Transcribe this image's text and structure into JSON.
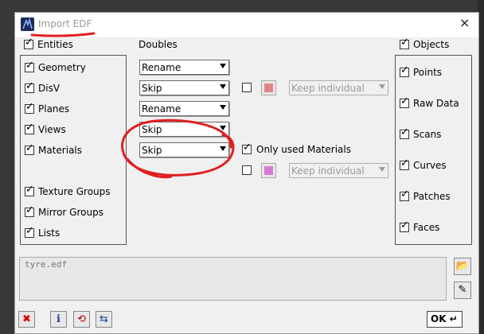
{
  "window": {
    "title": "Import EDF",
    "close_glyph": "×"
  },
  "headers": {
    "entities": "Entities",
    "doubles": "Doubles",
    "objects": "Objects"
  },
  "entities": [
    {
      "label": "Geometry",
      "checked": true
    },
    {
      "label": "DisV",
      "checked": true
    },
    {
      "label": "Planes",
      "checked": true
    },
    {
      "label": "Views",
      "checked": true
    },
    {
      "label": "Materials",
      "checked": true
    },
    {
      "label": "Texture Groups",
      "checked": true
    },
    {
      "label": "Mirror Groups",
      "checked": true
    },
    {
      "label": "Lists",
      "checked": true
    }
  ],
  "doubles": [
    "Rename",
    "Skip",
    "Rename",
    "Skip",
    "Skip"
  ],
  "disv_options": {
    "checked": false,
    "swatch_color": "#e08585",
    "select": "Keep individual"
  },
  "only_used_materials": {
    "label": "Only used Materials",
    "checked": true
  },
  "materials_options": {
    "checked": false,
    "swatch_color": "#d77ad6",
    "select": "Keep individual"
  },
  "objects": [
    {
      "label": "Points",
      "checked": true
    },
    {
      "label": "Raw Data",
      "checked": true
    },
    {
      "label": "Scans",
      "checked": true
    },
    {
      "label": "Curves",
      "checked": true
    },
    {
      "label": "Patches",
      "checked": true
    },
    {
      "label": "Faces",
      "checked": true
    }
  ],
  "file": {
    "name": "tyre.edf"
  },
  "buttons": {
    "ok": "OK",
    "ok_glyph": "↵"
  },
  "annotation": {
    "color": "#e02020"
  }
}
